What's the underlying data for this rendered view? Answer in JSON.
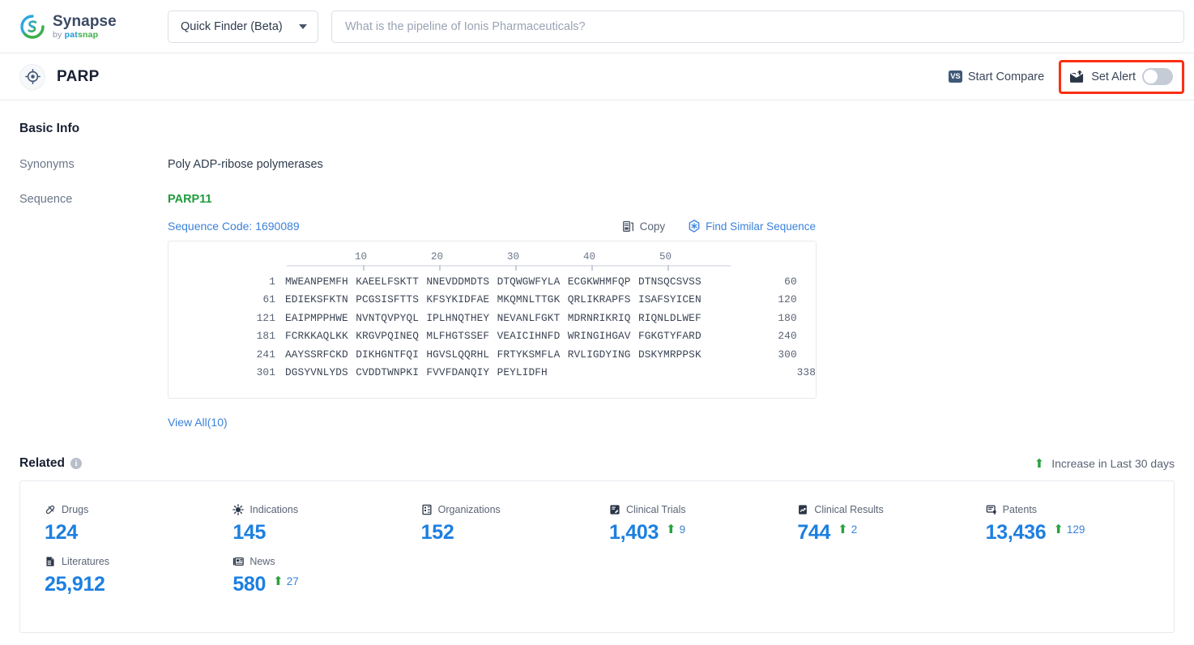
{
  "topbar": {
    "logo": {
      "name": "Synapse",
      "by": "by ",
      "brand_pat": "pat",
      "brand_snap": "snap"
    },
    "finder": {
      "label": "Quick Finder (Beta)",
      "icon": "chevron-down-icon"
    },
    "search": {
      "value": "",
      "placeholder": "What is the pipeline of Ionis Pharmaceuticals?"
    }
  },
  "entity": {
    "icon": "target-icon",
    "title": "PARP",
    "start_compare": {
      "label": "Start Compare",
      "badge": "VS"
    },
    "set_alert": {
      "label": "Set Alert",
      "icon": "alert-mail-icon",
      "toggle_state": "off"
    },
    "highlight_color": "#f92f12"
  },
  "basic_info": {
    "heading": "Basic Info",
    "rows": [
      {
        "label": "Synonyms",
        "value": "Poly ADP-ribose polymerases"
      },
      {
        "label": "Sequence",
        "value": ""
      }
    ],
    "sequence": {
      "name": "PARP11",
      "code_label": "Sequence Code: 1690089",
      "copy_label": "Copy",
      "copy_icon": "copy-icon",
      "find_similar_label": "Find Similar Sequence",
      "find_similar_icon": "find-similar-icon",
      "ruler_ticks": [
        "10",
        "20",
        "30",
        "40",
        "50"
      ],
      "lines": [
        {
          "start": "1",
          "chunks": [
            "MWEANPEMFH",
            "KAEELFSKTT",
            "NNEVDDMDTS",
            "DTQWGWFYLA",
            "ECGKWHMFQP",
            "DTNSQCSVSS"
          ],
          "end": "60"
        },
        {
          "start": "61",
          "chunks": [
            "EDIEKSFKTN",
            "PCGSISFTTS",
            "KFSYKIDFAE",
            "MKQMNLTTGK",
            "QRLIKRAPFS",
            "ISAFSYICEN"
          ],
          "end": "120"
        },
        {
          "start": "121",
          "chunks": [
            "EAIPMPPHWE",
            "NVNTQVPYQL",
            "IPLHNQTHEY",
            "NEVANLFGKT",
            "MDRNRIKRIQ",
            "RIQNLDLWEF"
          ],
          "end": "180"
        },
        {
          "start": "181",
          "chunks": [
            "FCRKKAQLKK",
            "KRGVPQINEQ",
            "MLFHGTSSEF",
            "VEAICIHNFD",
            "WRINGIHGAV",
            "FGKGTYFARD"
          ],
          "end": "240"
        },
        {
          "start": "241",
          "chunks": [
            "AAYSSRFCKD",
            "DIKHGNTFQI",
            "HGVSLQQRHL",
            "FRTYKSMFLA",
            "RVLIGDYING",
            "DSKYMRPPSK"
          ],
          "end": "300"
        },
        {
          "start": "301",
          "chunks": [
            "DGSYVNLYDS",
            "CVDDTWNPKI",
            "FVVFDANQIY",
            "PEYLIDFH"
          ],
          "end": "338"
        }
      ],
      "view_all": "View All(10)"
    }
  },
  "related": {
    "heading": "Related",
    "info_icon": "info-icon",
    "legend": {
      "label": "Increase in Last 30 days",
      "icon": "arrow-up-icon",
      "color": "#2aa33f"
    },
    "items": [
      {
        "label": "Drugs",
        "icon": "pill-icon",
        "value": "124",
        "delta": ""
      },
      {
        "label": "Indications",
        "icon": "virus-icon",
        "value": "145",
        "delta": ""
      },
      {
        "label": "Organizations",
        "icon": "building-icon",
        "value": "152",
        "delta": ""
      },
      {
        "label": "Clinical Trials",
        "icon": "clinical-trial-icon",
        "value": "1,403",
        "delta": "9"
      },
      {
        "label": "Clinical Results",
        "icon": "clinical-result-icon",
        "value": "744",
        "delta": "2"
      },
      {
        "label": "Patents",
        "icon": "patent-icon",
        "value": "13,436",
        "delta": "129"
      },
      {
        "label": "Literatures",
        "icon": "literature-icon",
        "value": "25,912",
        "delta": ""
      },
      {
        "label": "News",
        "icon": "news-icon",
        "value": "580",
        "delta": "27"
      }
    ]
  }
}
